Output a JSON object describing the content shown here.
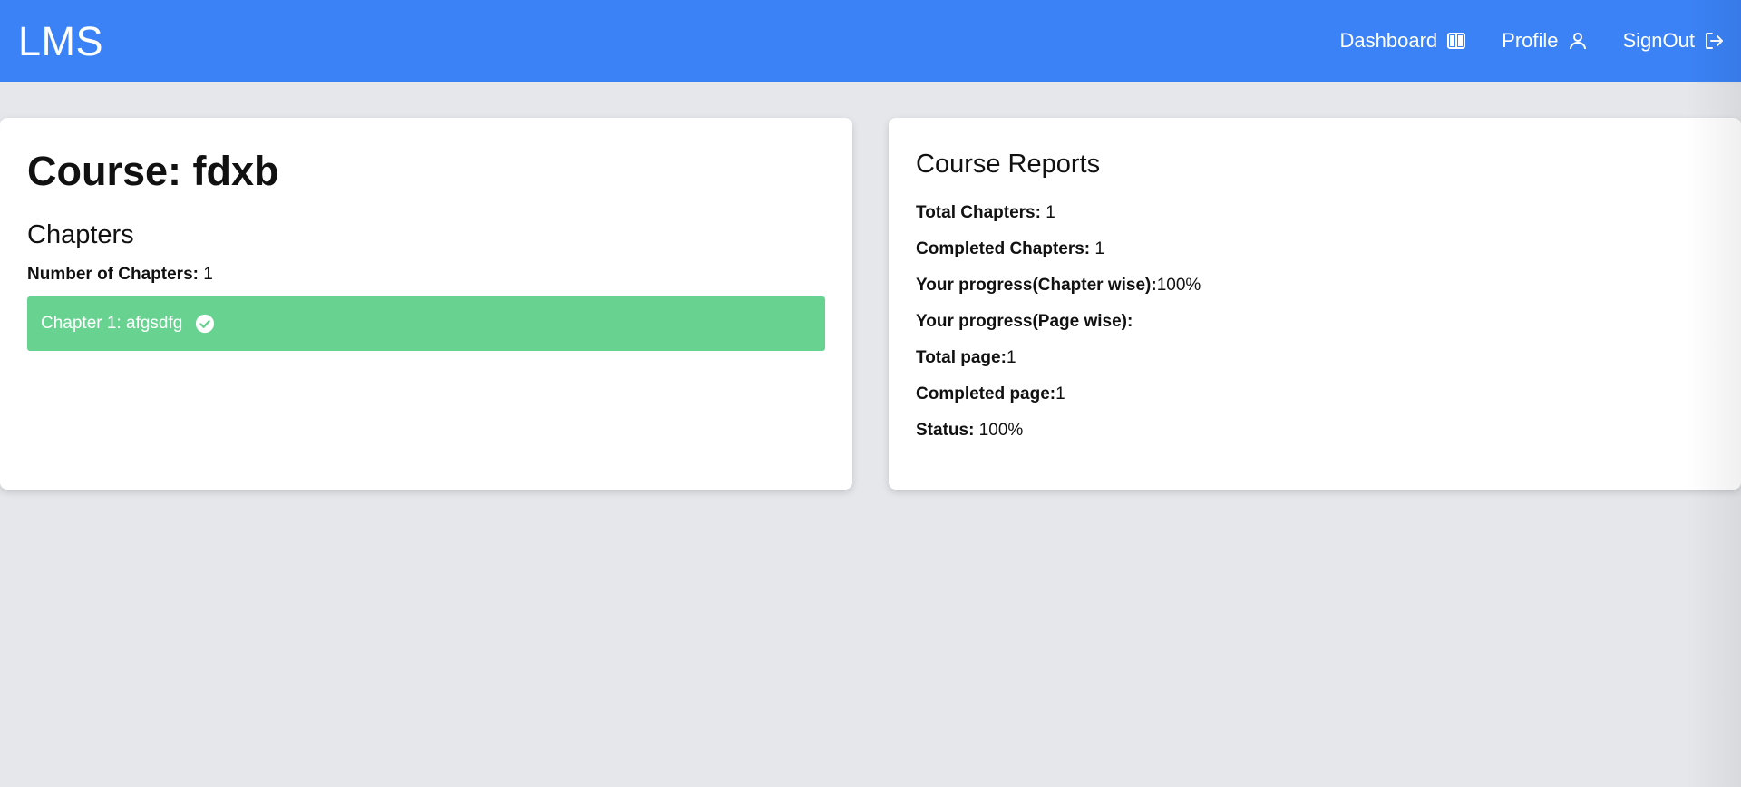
{
  "header": {
    "brand": "LMS",
    "nav": [
      {
        "label": "Dashboard",
        "icon": "dashboard-icon"
      },
      {
        "label": "Profile",
        "icon": "user-icon"
      },
      {
        "label": "SignOut",
        "icon": "signout-icon"
      }
    ]
  },
  "colors": {
    "header_bg": "#3b82f6",
    "page_bg": "#e5e7eb",
    "chapter_complete_bg": "#68d391"
  },
  "course": {
    "title": "Course: fdxb",
    "chapters_heading": "Chapters",
    "number_label": "Number of Chapters:",
    "number_value": " 1",
    "chapters": [
      {
        "label": "Chapter 1: afgsdfg",
        "completed": true,
        "icon": "check-circle-icon"
      }
    ]
  },
  "reports": {
    "title": "Course Reports",
    "rows": [
      {
        "label": "Total Chapters:",
        "value": " 1"
      },
      {
        "label": "Completed Chapters:",
        "value": " 1"
      },
      {
        "label": "Your progress(Chapter wise):",
        "value": "100%"
      },
      {
        "label": "Your progress(Page wise):",
        "value": ""
      },
      {
        "label": "Total page:",
        "value": "1"
      },
      {
        "label": "Completed page:",
        "value": "1"
      },
      {
        "label": "Status:",
        "value": " 100%"
      }
    ]
  }
}
